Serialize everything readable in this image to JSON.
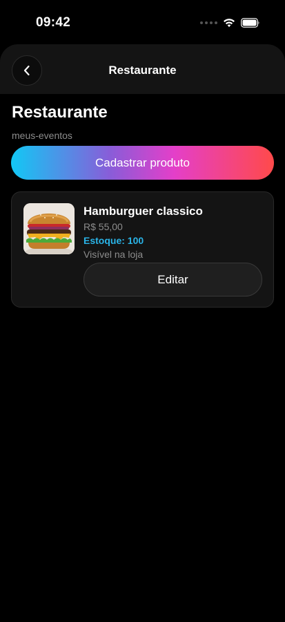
{
  "status_bar": {
    "time": "09:42"
  },
  "header": {
    "title": "Restaurante"
  },
  "page": {
    "title": "Restaurante",
    "subtitle": "meus-eventos"
  },
  "actions": {
    "create_product_label": "Cadastrar produto"
  },
  "products": [
    {
      "name": "Hamburguer classico",
      "price": "R$ 55,00",
      "stock": "Estoque: 100",
      "visibility": "Visível na loja",
      "edit_label": "Editar",
      "image_icon": "burger-photo"
    }
  ],
  "colors": {
    "background": "#000000",
    "card": "#141414",
    "stock_accent": "#2ab4e8",
    "gradient": [
      "#12c8f5",
      "#8a5cd8",
      "#e43fc9",
      "#ff4a4a"
    ]
  }
}
